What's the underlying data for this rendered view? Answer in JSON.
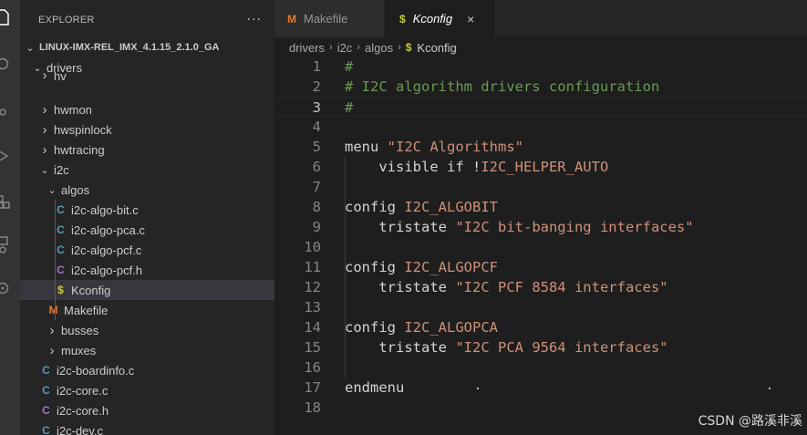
{
  "activity": {
    "icons": [
      "files-icon",
      "search-icon",
      "source-control-icon",
      "run-debug-icon",
      "extensions-icon",
      "remote-icon",
      "gear-icon"
    ]
  },
  "explorer": {
    "title": "EXPLORER",
    "more": "···",
    "root": "LINUX-IMX-REL_IMX_4.1.15_2.1.0_GA",
    "items": [
      {
        "label": "drivers",
        "kind": "folder",
        "open": true
      },
      {
        "label": "hv",
        "kind": "folder",
        "open": false
      },
      {
        "label": "hwmon",
        "kind": "folder",
        "open": false
      },
      {
        "label": "hwspinlock",
        "kind": "folder",
        "open": false
      },
      {
        "label": "hwtracing",
        "kind": "folder",
        "open": false
      },
      {
        "label": "i2c",
        "kind": "folder",
        "open": true
      },
      {
        "label": "algos",
        "kind": "folder",
        "open": true
      },
      {
        "label": "i2c-algo-bit.c",
        "kind": "c",
        "icon": "C"
      },
      {
        "label": "i2c-algo-pca.c",
        "kind": "c",
        "icon": "C"
      },
      {
        "label": "i2c-algo-pcf.c",
        "kind": "c",
        "icon": "C"
      },
      {
        "label": "i2c-algo-pcf.h",
        "kind": "h",
        "icon": "C"
      },
      {
        "label": "Kconfig",
        "kind": "kconfig",
        "icon": "$"
      },
      {
        "label": "Makefile",
        "kind": "makefile",
        "icon": "M"
      },
      {
        "label": "busses",
        "kind": "folder",
        "open": false
      },
      {
        "label": "muxes",
        "kind": "folder",
        "open": false
      },
      {
        "label": "i2c-boardinfo.c",
        "kind": "c",
        "icon": "C"
      },
      {
        "label": "i2c-core.c",
        "kind": "c",
        "icon": "C"
      },
      {
        "label": "i2c-core.h",
        "kind": "h",
        "icon": "C"
      },
      {
        "label": "i2c-dev.c",
        "kind": "c",
        "icon": "C"
      }
    ]
  },
  "tabs": [
    {
      "label": "Makefile",
      "icon": "M",
      "active": false
    },
    {
      "label": "Kconfig",
      "icon": "$",
      "active": true,
      "close": "×"
    }
  ],
  "breadcrumb": [
    "drivers",
    "i2c",
    "algos",
    "Kconfig"
  ],
  "breadcrumb_icon": "$",
  "code": {
    "lines": [
      {
        "n": "1",
        "parts": [
          [
            "c-comment",
            "#"
          ]
        ]
      },
      {
        "n": "2",
        "parts": [
          [
            "c-comment",
            "# I2C algorithm drivers configuration"
          ]
        ]
      },
      {
        "n": "3",
        "parts": [
          [
            "c-comment",
            "#"
          ]
        ]
      },
      {
        "n": "4",
        "parts": []
      },
      {
        "n": "5",
        "parts": [
          [
            "c-kw",
            "menu "
          ],
          [
            "c-str",
            "\"I2C Algorithms\""
          ]
        ]
      },
      {
        "n": "6",
        "parts": [
          [
            "c-kw",
            "    visible if !"
          ],
          [
            "c-sym",
            "I2C_HELPER_AUTO"
          ]
        ]
      },
      {
        "n": "7",
        "parts": []
      },
      {
        "n": "8",
        "parts": [
          [
            "c-kw",
            "config "
          ],
          [
            "c-sym",
            "I2C_ALGOBIT"
          ]
        ]
      },
      {
        "n": "9",
        "parts": [
          [
            "c-kw",
            "    tristate "
          ],
          [
            "c-str",
            "\"I2C bit-banging interfaces\""
          ]
        ]
      },
      {
        "n": "10",
        "parts": []
      },
      {
        "n": "11",
        "parts": [
          [
            "c-kw",
            "config "
          ],
          [
            "c-sym",
            "I2C_ALGOPCF"
          ]
        ]
      },
      {
        "n": "12",
        "parts": [
          [
            "c-kw",
            "    tristate "
          ],
          [
            "c-str",
            "\"I2C PCF 8584 interfaces\""
          ]
        ]
      },
      {
        "n": "13",
        "parts": []
      },
      {
        "n": "14",
        "parts": [
          [
            "c-kw",
            "config "
          ],
          [
            "c-sym",
            "I2C_ALGOPCA"
          ]
        ]
      },
      {
        "n": "15",
        "parts": [
          [
            "c-kw",
            "    tristate "
          ],
          [
            "c-str",
            "\"I2C PCA 9564 interfaces\""
          ]
        ]
      },
      {
        "n": "16",
        "parts": []
      },
      {
        "n": "17",
        "parts": [
          [
            "c-kw",
            "endmenu"
          ]
        ]
      },
      {
        "n": "18",
        "parts": []
      }
    ],
    "current_line": "3"
  },
  "watermark": "CSDN @路溪非溪",
  "colors": {
    "c_icon": "#519aba",
    "h_icon": "#a074c4",
    "kconfig_icon": "#cbcb41",
    "makefile_icon": "#e37933"
  }
}
